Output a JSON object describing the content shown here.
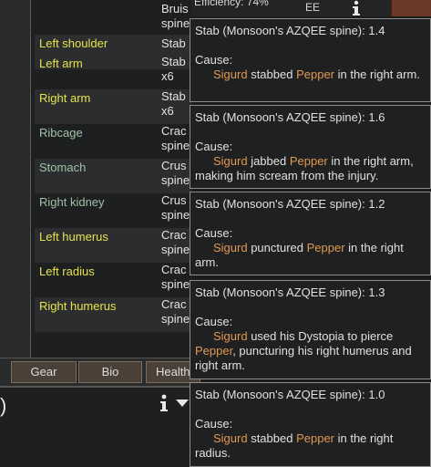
{
  "efficiency_text": "Efficiency: 74%",
  "header_fragment": "EE",
  "rows": [
    {
      "part": "",
      "injury": "Bruis\nspine",
      "color": "none"
    },
    {
      "part": "Left shoulder",
      "injury": "Stab",
      "color": "yellow"
    },
    {
      "part": "Left arm",
      "injury": "Stab\nx6",
      "color": "yellow"
    },
    {
      "part": "Right arm",
      "injury": "Stab\nx6",
      "color": "yellow"
    },
    {
      "part": "Ribcage",
      "injury": "Crac\nspine",
      "color": "green"
    },
    {
      "part": "Stomach",
      "injury": "Crus\nspine",
      "color": "green"
    },
    {
      "part": "Right kidney",
      "injury": "Crus\nspine",
      "color": "green"
    },
    {
      "part": "Left humerus",
      "injury": "Crac\nspine",
      "color": "yellow"
    },
    {
      "part": "Left radius",
      "injury": "Crac\nspine",
      "color": "yellow"
    },
    {
      "part": "Right humerus",
      "injury": "Crac\nspine",
      "color": "yellow"
    }
  ],
  "tabs": [
    {
      "label": "Gear"
    },
    {
      "label": "Bio"
    },
    {
      "label": "Health"
    }
  ],
  "bottom_paren": ")",
  "tooltips": [
    {
      "header": "Stab (Monsoon's AZQEE spine): 1.4",
      "cause_label": "Cause:",
      "attacker": "Sigurd",
      "pre": " stabbed ",
      "victim": "Pepper",
      "post": " in the right arm."
    },
    {
      "header": "Stab (Monsoon's AZQEE spine): 1.6",
      "cause_label": "Cause:",
      "attacker": "Sigurd",
      "pre": " jabbed ",
      "victim": "Pepper",
      "post": " in the right arm, making him scream from the injury."
    },
    {
      "header": "Stab (Monsoon's AZQEE spine): 1.2",
      "cause_label": "Cause:",
      "attacker": "Sigurd",
      "pre": " punctured ",
      "victim": "Pepper",
      "post": " in the right arm."
    },
    {
      "header": "Stab (Monsoon's AZQEE spine): 1.3",
      "cause_label": "Cause:",
      "attacker": "Sigurd",
      "pre": " used his Dystopia to pierce ",
      "victim": "Pepper",
      "post": ", puncturing his right humerus and right arm."
    },
    {
      "header": "Stab (Monsoon's AZQEE spine): 1.0",
      "cause_label": "Cause:",
      "attacker": "Sigurd",
      "pre": " stabbed ",
      "victim": "Pepper",
      "post": " in the right radius."
    }
  ],
  "icons": {
    "info": "info-icon",
    "dropdown": "triangle-down-icon"
  },
  "colors": {
    "attacker": "#e09a52",
    "victim": "#e09a52",
    "label_yellow": "#e6e34e",
    "label_green": "#9fc2a9"
  }
}
